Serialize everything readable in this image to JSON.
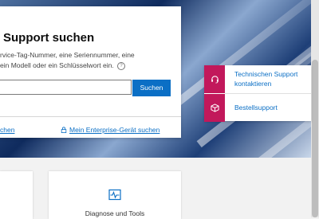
{
  "search": {
    "title": "Support suchen",
    "description_line1": "rvice-Tag-Nummer, eine Seriennummer, eine",
    "description_line2": "ein Modell oder ein Schlüsselwort ein.",
    "input_value": "",
    "button_label": "Suchen"
  },
  "links": {
    "left_label": "chen",
    "enterprise_label": "Mein Enterprise-Gerät suchen"
  },
  "support_panel": {
    "items": [
      {
        "label_line1": "Technischen Support",
        "label_line2": "kontaktieren",
        "icon": "headset-icon"
      },
      {
        "label_line1": "Bestellsupport",
        "icon": "package-icon"
      }
    ]
  },
  "cards": {
    "diagnose_label": "Diagnose und Tools",
    "diagnose_icon": "pulse-monitor-icon"
  },
  "colors": {
    "accent_blue": "#0b6fc5",
    "support_magenta": "#c2185b"
  }
}
